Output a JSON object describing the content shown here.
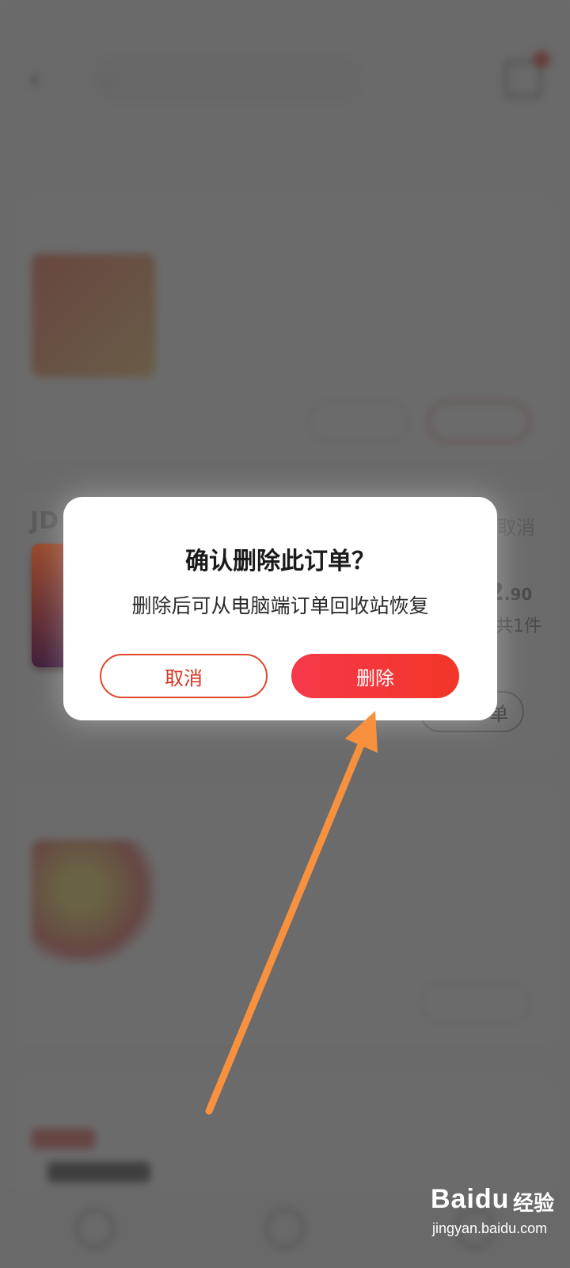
{
  "background": {
    "status_bar": {
      "left": "",
      "right": ""
    },
    "topbar": {
      "filter_label": "",
      "search_placeholder": ""
    },
    "tabs": [
      {
        "label": "",
        "active": true
      },
      {
        "label": ""
      },
      {
        "label": ""
      },
      {
        "label": ""
      },
      {
        "label": ""
      }
    ],
    "card2_peek": {
      "store_prefix": "JD",
      "status": "取消",
      "price_int": "2",
      "price_dec": ".90",
      "qty": "共1件",
      "action": "单"
    }
  },
  "dialog": {
    "title": "确认删除此订单？",
    "message": "删除后可从电脑端订单回收站恢复",
    "cancel_label": "取消",
    "delete_label": "删除"
  },
  "annotation": {
    "color": "#f7913d"
  },
  "watermark": {
    "brand": "Baidu",
    "product": "经验",
    "url": "jingyan.baidu.com"
  },
  "colors": {
    "accent": "#e2231a",
    "delete_button": "#f5384a",
    "overlay": "#464646"
  }
}
